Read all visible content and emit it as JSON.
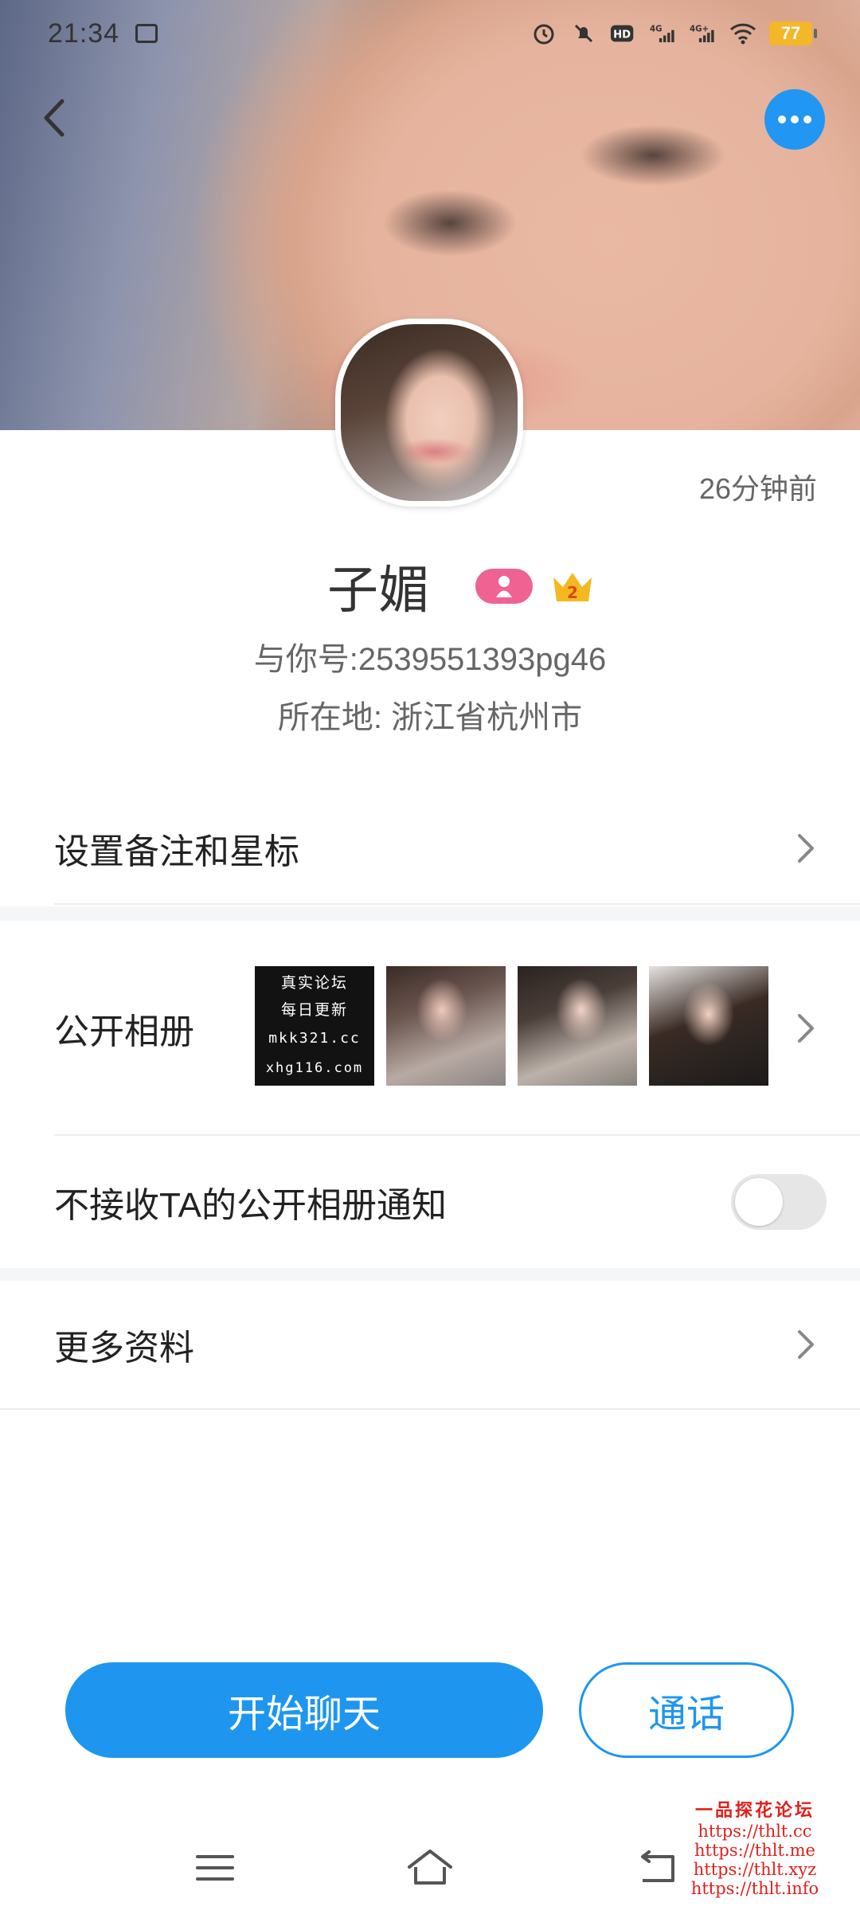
{
  "status_bar": {
    "time": "21:34",
    "battery": "77",
    "icons": [
      "alarm-icon",
      "mute-icon",
      "hd-icon",
      "signal-4g-icon",
      "signal-4g-plus-icon",
      "wifi-icon"
    ]
  },
  "profile": {
    "last_seen": "26分钟前",
    "name": "子媚",
    "crown_level": "2",
    "account_id": "与你号:2539551393pg46",
    "location": "所在地: 浙江省杭州市"
  },
  "rows": {
    "remark_label": "设置备注和星标",
    "album_label": "公开相册",
    "notify_label": "不接收TA的公开相册通知",
    "more_label": "更多资料"
  },
  "album_thumb_text": {
    "line1": "真实论坛",
    "line2": "每日更新",
    "line3": "mkk321.cc",
    "line4": "xhg116.com"
  },
  "toggle": {
    "notify_off": false
  },
  "actions": {
    "chat_label": "开始聊天",
    "call_label": "通话"
  },
  "watermark": {
    "title": "一品探花论坛",
    "urls": [
      "https://thlt.cc",
      "https://thlt.me",
      "https://thlt.xyz",
      "https://thlt.info"
    ]
  },
  "colors": {
    "accent": "#1e96f0",
    "gender_badge": "#f06292",
    "crown": "#f5b820",
    "battery": "#f4b728"
  }
}
